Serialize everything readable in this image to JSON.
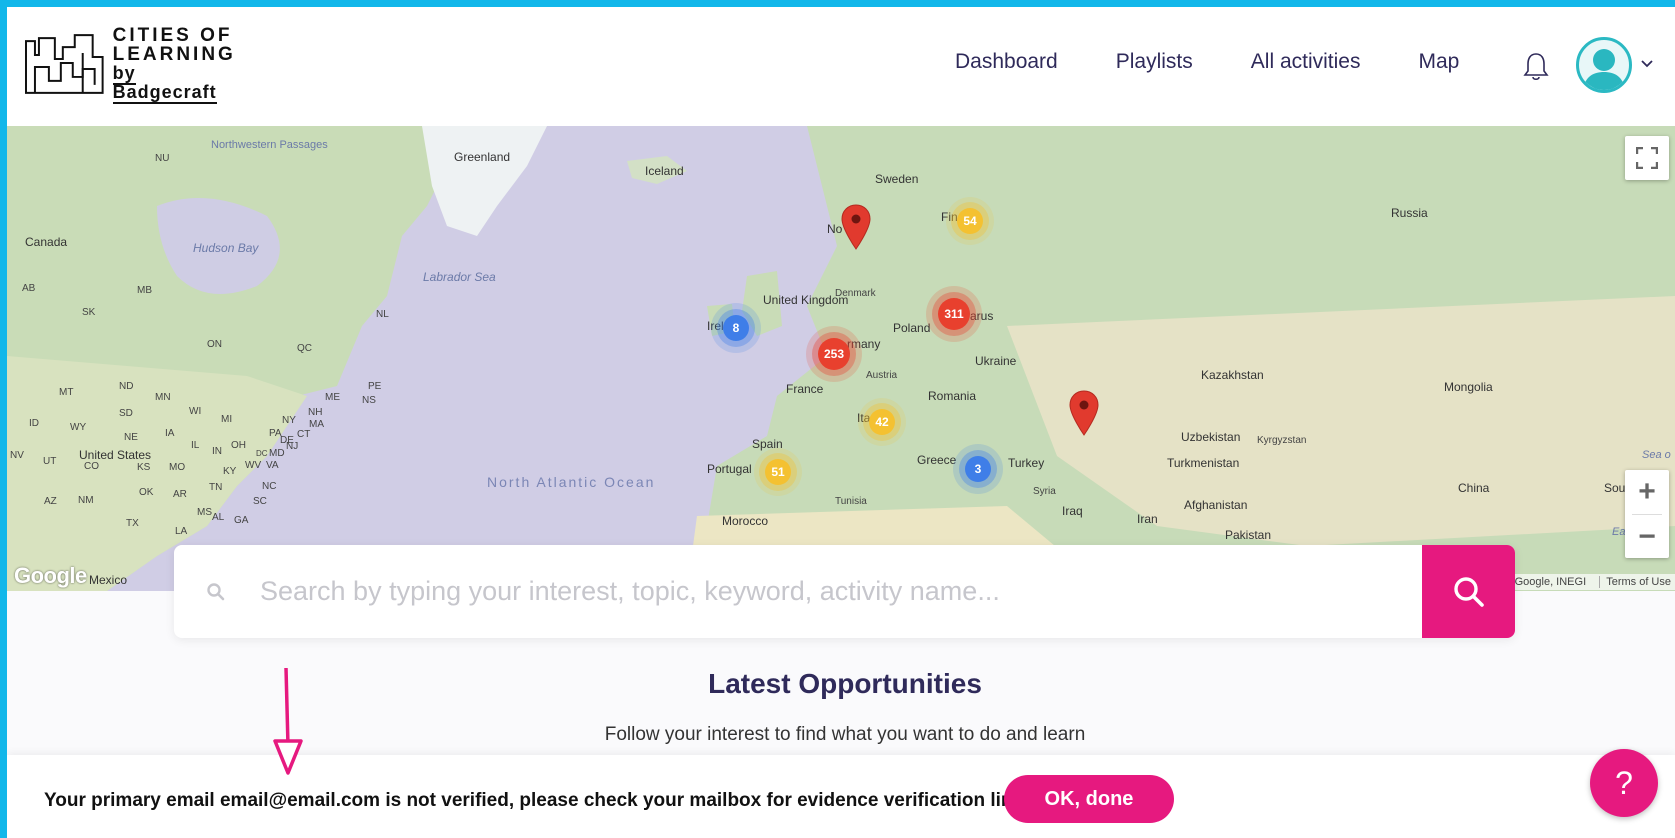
{
  "brand": {
    "logo_line1": "CITIES OF",
    "logo_line2": "LEARNING",
    "logo_line3": "by Badgecraft"
  },
  "nav": {
    "items": [
      "Dashboard",
      "Playlists",
      "All activities",
      "Map"
    ]
  },
  "map": {
    "labels": {
      "nw_passages": "Northwestern Passages",
      "greenland": "Greenland",
      "iceland": "Iceland",
      "sweden": "Sweden",
      "fin": "Fin",
      "russia": "Russia",
      "nu": "NU",
      "canada": "Canada",
      "hudson_bay": "Hudson Bay",
      "labrador_sea": "Labrador Sea",
      "nor": "No",
      "denmark": "Denmark",
      "uk": "United Kingdom",
      "ire": "Irel",
      "germany": "rmany",
      "poland": "Poland",
      "belarus": "arus",
      "ukraine": "Ukraine",
      "austria": "Austria",
      "france": "France",
      "romania": "Romania",
      "kazakhstan": "Kazakhstan",
      "mongolia": "Mongolia",
      "ita": "Ita",
      "spain": "Spain",
      "portugal": "Portugal",
      "greece": "Greece",
      "turkey": "Turkey",
      "uzbekistan": "Uzbekistan",
      "kyrgyzstan": "Kyrgyzstan",
      "turkmenistan": "Turkmenistan",
      "syria": "Syria",
      "iraq": "Iraq",
      "iran": "Iran",
      "afghanistan": "Afghanistan",
      "pakistan": "Pakistan",
      "china": "China",
      "south": "South",
      "east_ch": "East Ch",
      "sea_of": "Sea o",
      "tunisia": "Tunisia",
      "morocco": "Morocco",
      "north_atlantic": "North Atlantic Ocean",
      "united_states": "United States",
      "mexico": "Mexico",
      "ab": "AB",
      "sk": "SK",
      "mb": "MB",
      "on": "ON",
      "qc": "QC",
      "nl": "NL",
      "mt": "MT",
      "nd": "ND",
      "sd": "SD",
      "mn": "MN",
      "wi": "WI",
      "mi": "MI",
      "id": "ID",
      "wy": "WY",
      "ne": "NE",
      "ia": "IA",
      "il": "IL",
      "in": "IN",
      "oh": "OH",
      "pa": "PA",
      "ny": "NY",
      "me": "ME",
      "nh": "NH",
      "ns": "NS",
      "pe": "PE",
      "ma": "MA",
      "nv": "NV",
      "ut": "UT",
      "co": "CO",
      "ks": "KS",
      "mo": "MO",
      "ky": "KY",
      "wv": "WV",
      "va": "VA",
      "md": "MD",
      "dc": "DC",
      "az": "AZ",
      "nm": "NM",
      "ok": "OK",
      "ar": "AR",
      "tn": "TN",
      "nc": "NC",
      "tx": "TX",
      "la": "LA",
      "ms": "MS",
      "al": "AL",
      "ga": "GA",
      "sc": "SC",
      "de": "DE",
      "nj": "NJ",
      "ct": "CT"
    },
    "clusters": [
      {
        "id": "ireland",
        "count": "8",
        "color": "blue"
      },
      {
        "id": "central-europe",
        "count": "253",
        "color": "red"
      },
      {
        "id": "baltic",
        "count": "311",
        "color": "red"
      },
      {
        "id": "finland",
        "count": "54",
        "color": "yellow"
      },
      {
        "id": "italy",
        "count": "42",
        "color": "yellow"
      },
      {
        "id": "iberia",
        "count": "51",
        "color": "yellow"
      },
      {
        "id": "turkey",
        "count": "3",
        "color": "blue"
      }
    ],
    "google_logo": "Google",
    "attribution": "Google, INEGI",
    "terms": "Terms of Use",
    "zoom_in": "+",
    "zoom_out": "−"
  },
  "search": {
    "placeholder": "Search by typing your interest, topic, keyword, activity name..."
  },
  "latest": {
    "title": "Latest Opportunities",
    "subtitle": "Follow your interest to find what you want to do and learn"
  },
  "banner": {
    "message": "Your primary email email@email.com is not verified, please check your mailbox for evidence verification link.",
    "button": "OK, done"
  },
  "help": {
    "label": "?"
  },
  "colors": {
    "accent": "#e6197f",
    "frame": "#12b7ea",
    "nav_text": "#2f2a5a",
    "cluster_blue": "#3f7ee8",
    "cluster_red": "#e8402e",
    "cluster_yellow": "#f4c131"
  },
  "icons": [
    "bell-icon",
    "avatar-icon",
    "chevron-down-icon",
    "search-icon",
    "fullscreen-icon",
    "map-pin-icon",
    "help-icon"
  ]
}
